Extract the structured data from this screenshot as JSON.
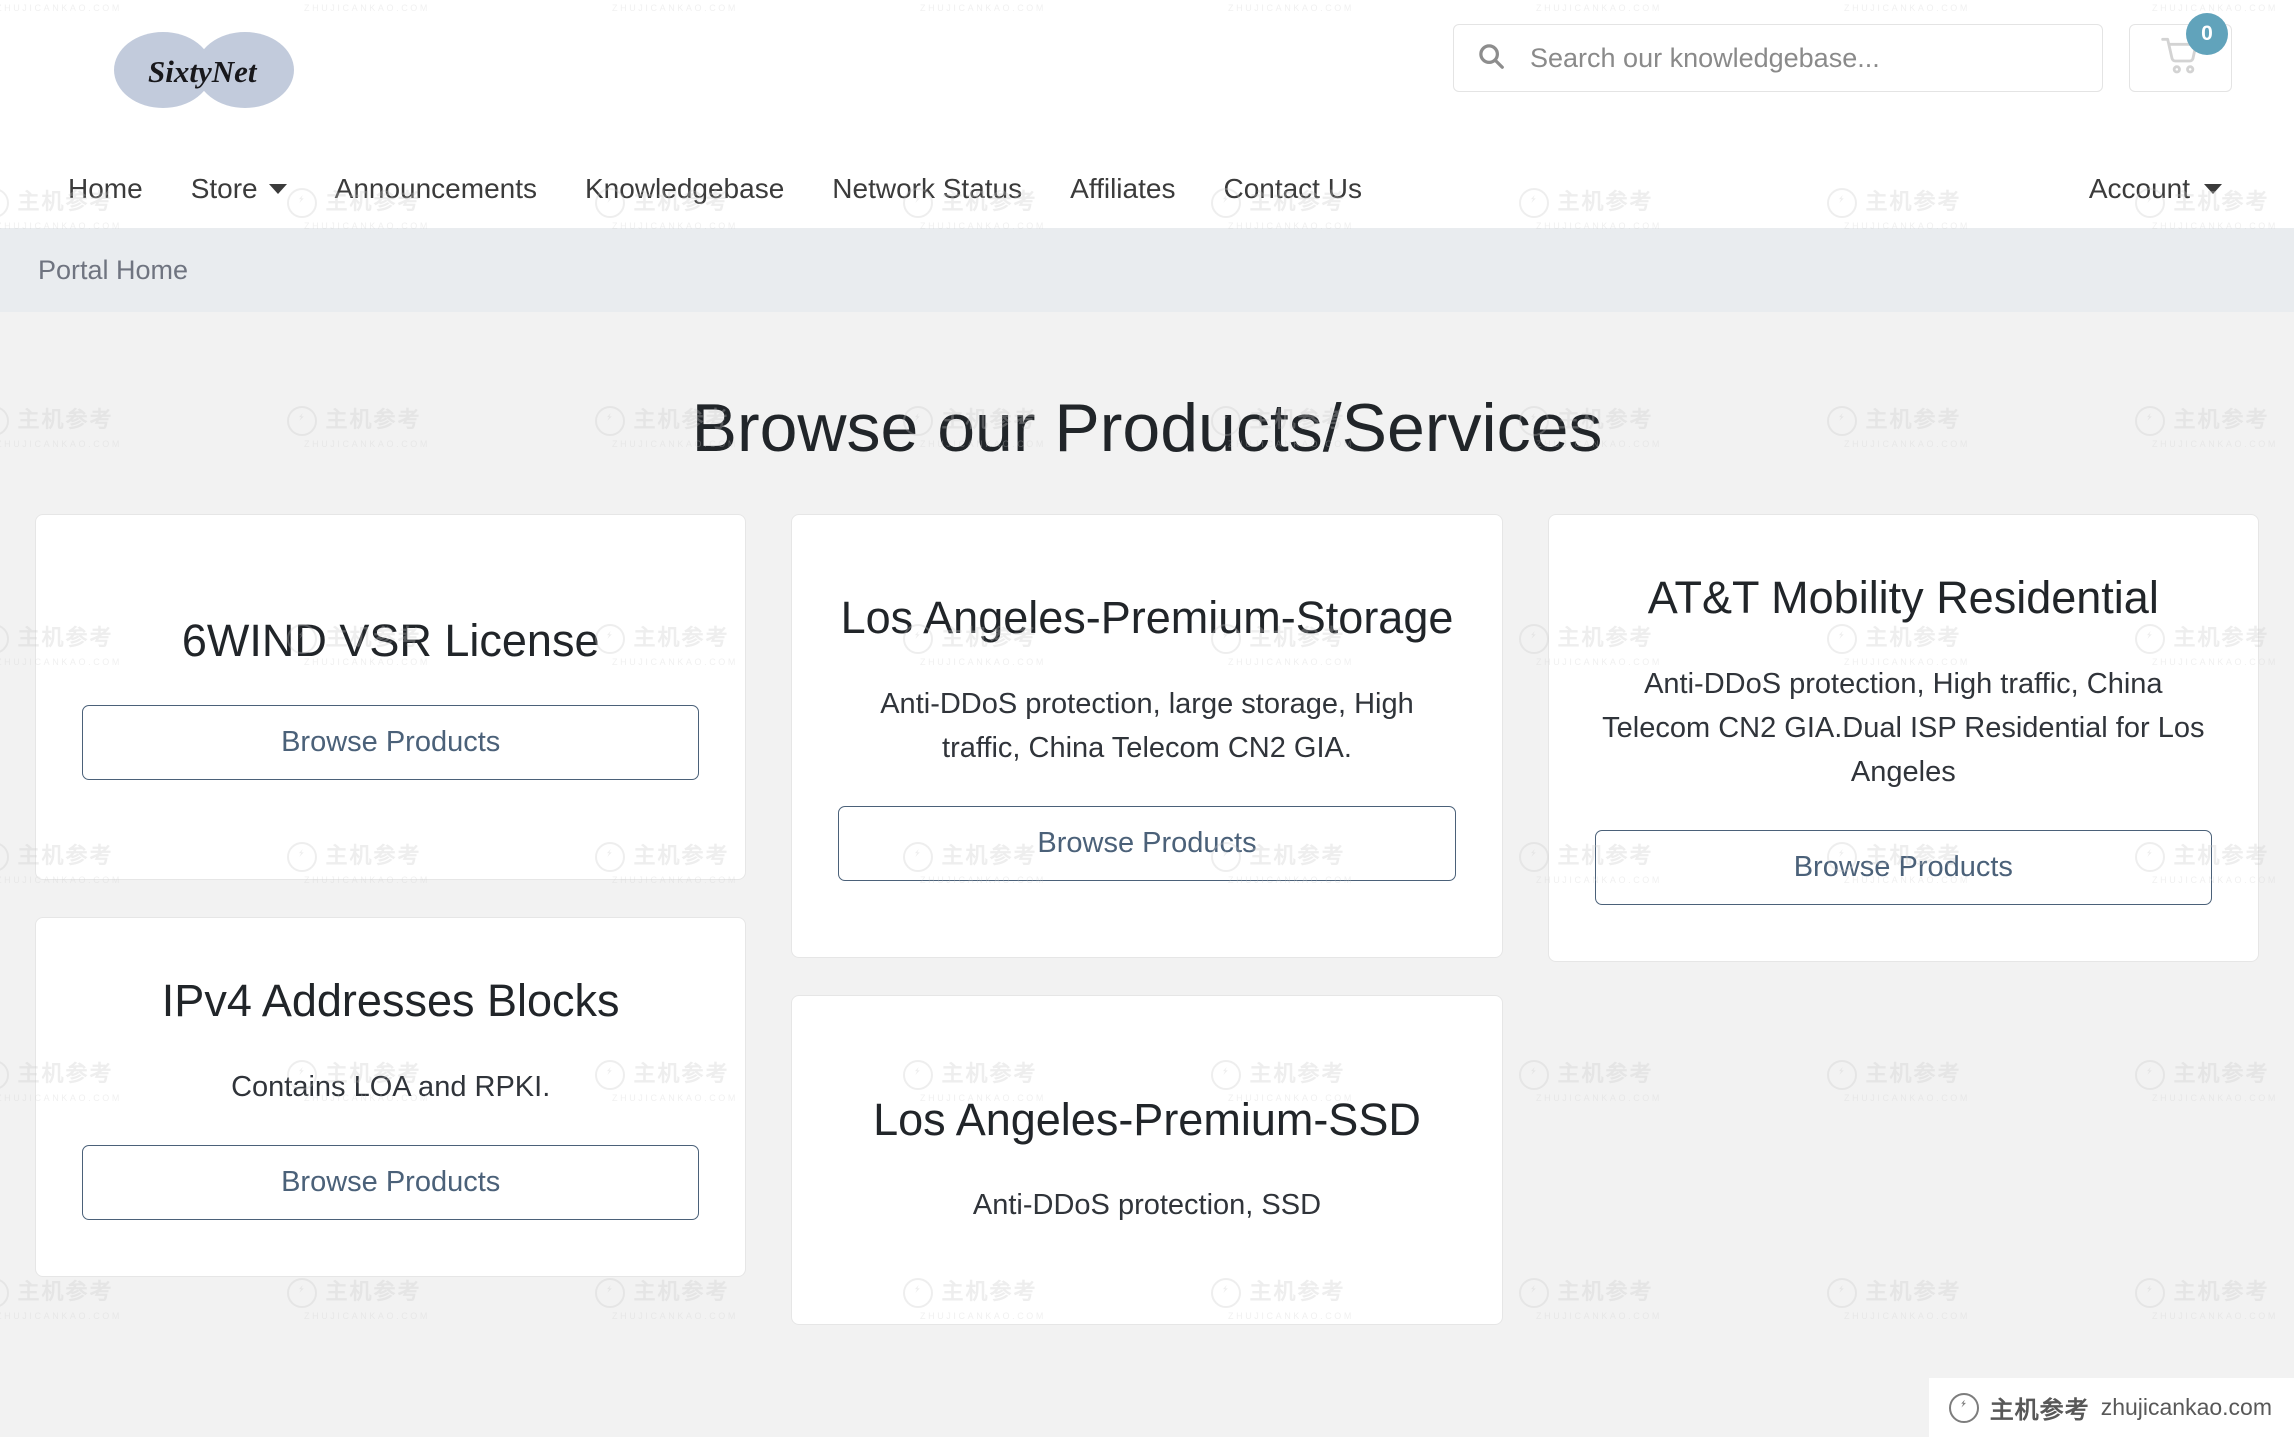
{
  "brand": {
    "logo_text": "SixtyNet"
  },
  "header": {
    "search": {
      "placeholder": "Search our knowledgebase...",
      "value": "",
      "icon": "search-icon"
    },
    "cart": {
      "icon": "shopping-cart-icon",
      "badge_count": "0",
      "badge_color": "#61a3bb"
    }
  },
  "nav": {
    "items": [
      {
        "label": "Home",
        "has_caret": false
      },
      {
        "label": "Store",
        "has_caret": true
      },
      {
        "label": "Announcements",
        "has_caret": false
      },
      {
        "label": "Knowledgebase",
        "has_caret": false
      },
      {
        "label": "Network Status",
        "has_caret": false
      },
      {
        "label": "Affiliates",
        "has_caret": false
      },
      {
        "label": "Contact Us",
        "has_caret": false
      }
    ],
    "account": {
      "label": "Account",
      "has_caret": true
    }
  },
  "breadcrumb": {
    "items": [
      "Portal Home"
    ]
  },
  "main": {
    "title": "Browse our Products/Services",
    "button_label": "Browse Products",
    "columns": [
      [
        {
          "title": "6WIND VSR License",
          "description": "",
          "size": "card-tall"
        },
        {
          "title": "IPv4 Addresses Blocks",
          "description": "Contains LOA and RPKI.",
          "size": "card-short"
        }
      ],
      [
        {
          "title": "Los Angeles-Premium-Storage",
          "description": "Anti-DDoS protection, large storage, High traffic, China Telecom CN2 GIA.",
          "size": "card-mid"
        },
        {
          "title": "Los Angeles-Premium-SSD",
          "description": "Anti-DDoS protection, SSD",
          "size": "card-last"
        }
      ],
      [
        {
          "title": "AT&T Mobility Residential",
          "description": "Anti-DDoS protection, High traffic, China Telecom CN2 GIA.Dual ISP Residential for Los Angeles",
          "size": "card-mid"
        }
      ]
    ]
  },
  "watermark": {
    "cn_text": "主机参考",
    "url_text": "ZHUJICANKAO.COM"
  },
  "corner_badge": {
    "cn_text": "主机参考",
    "url_text": "zhujicankao.com"
  }
}
